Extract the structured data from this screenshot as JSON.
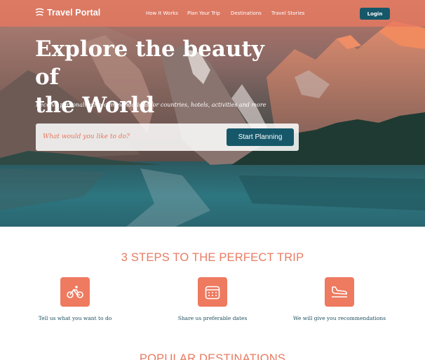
{
  "nav": {
    "brand": "Travel Portal",
    "links": [
      "How It Works",
      "Plan Your Trip",
      "Destinations",
      "Travel Stories"
    ],
    "login_label": "Login"
  },
  "hero": {
    "title_line1": "Explore the beauty of",
    "title_line2": "the World",
    "subtitle": "Receive personalized recommendations for countries, hotels, activities and more",
    "search_placeholder": "What would you like to do?",
    "button_label": "Start Planning"
  },
  "steps": {
    "title": "3 STEPS TO THE PERFECT TRIP",
    "items": [
      {
        "icon": "bicycle-icon",
        "text": "Tell us what you want to do"
      },
      {
        "icon": "calendar-icon",
        "text": "Share us preferable dates"
      },
      {
        "icon": "airplane-landing-icon",
        "text": "We will give you recommendations"
      }
    ]
  },
  "popular": {
    "title": "POPULAR DESTINATIONS"
  },
  "colors": {
    "accent": "#ee7a60",
    "primary_button": "#16586a",
    "step_text": "#1d4f5f"
  }
}
